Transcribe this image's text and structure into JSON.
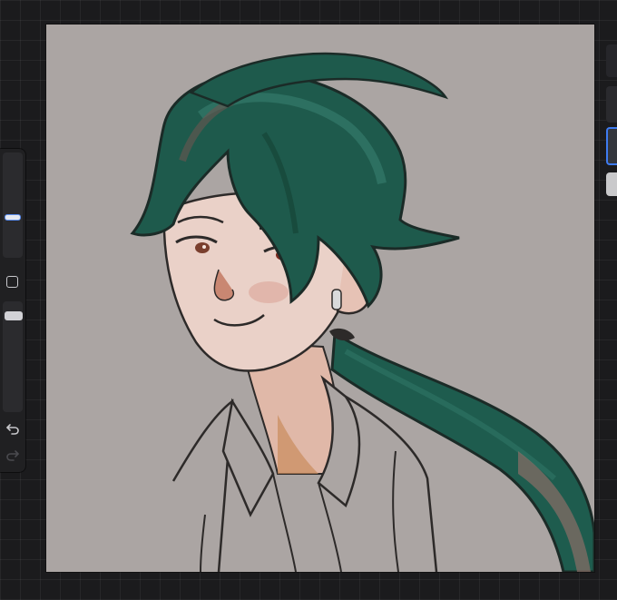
{
  "app": {
    "canvas_background": "#aba5a3",
    "accent_color": "#3e7bf0"
  },
  "sidebar": {
    "size_slider_level": 0.63,
    "opacity_slider_level": 0.08,
    "icons": [
      "modify-square-icon",
      "undo-icon",
      "redo-icon"
    ]
  },
  "layers_panel": {
    "visible_layer_thumbnails": 4,
    "selected_index": 2
  },
  "artwork": {
    "subject": "illustration",
    "hair_color": "#1e5a4c",
    "skin_color": "#ead1c8",
    "line_color": "#2d2a29"
  }
}
